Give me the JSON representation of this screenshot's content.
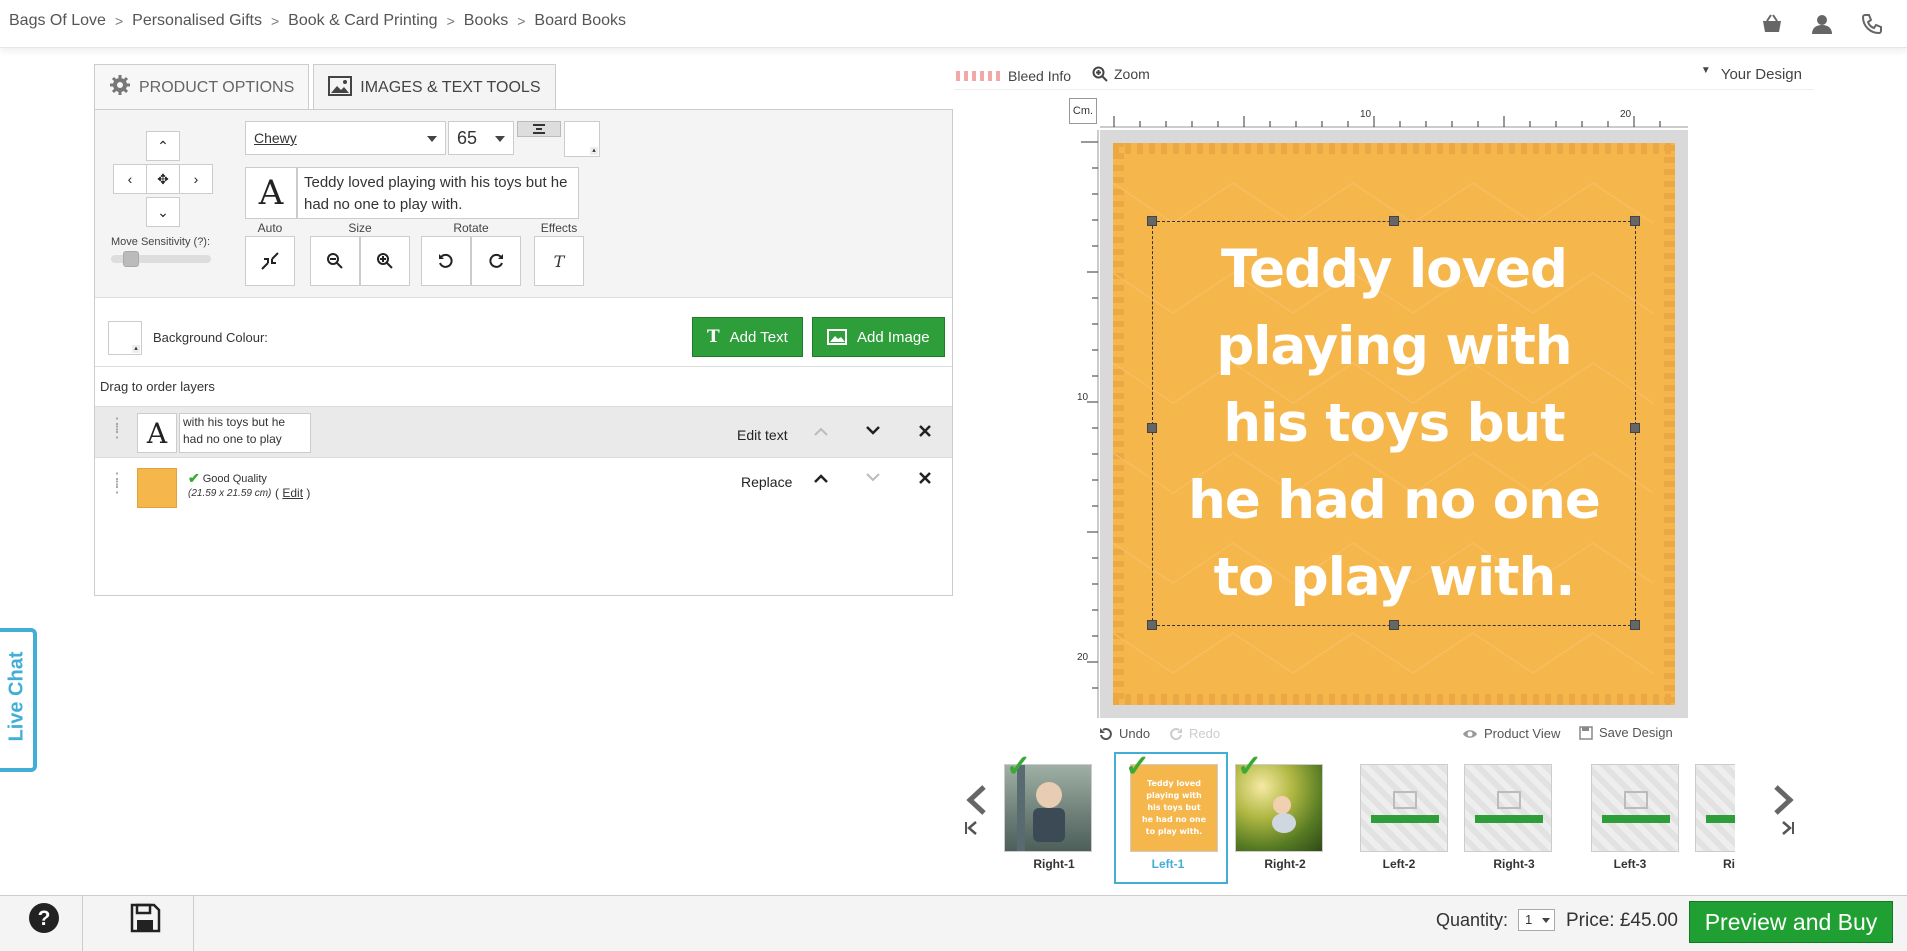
{
  "breadcrumb": [
    "Bags Of Love",
    "Personalised Gifts",
    "Book & Card Printing",
    "Books",
    "Board Books"
  ],
  "breadcrumb_sep": ">",
  "header_icons": [
    "basket-icon",
    "user-icon",
    "phone-icon"
  ],
  "tabs": [
    {
      "label": "PRODUCT OPTIONS",
      "icon": "gear-icon"
    },
    {
      "label": "IMAGES & TEXT TOOLS",
      "icon": "image-icon"
    }
  ],
  "text_tools": {
    "font": "Chewy",
    "font_size": "65",
    "text_value": "Teddy loved playing with his toys but he had no one to play with.",
    "move_sensitivity_label": "Move Sensitivity (?):",
    "labels": {
      "auto_size": "Auto Size",
      "size": "Size",
      "rotate": "Rotate",
      "effects": "Effects"
    }
  },
  "background": {
    "label": "Background Colour:"
  },
  "buttons": {
    "add_text": "Add Text",
    "add_image": "Add Image"
  },
  "layers": {
    "heading": "Drag to order layers",
    "items": [
      {
        "type": "text",
        "preview": "with his toys but he had no one to play",
        "action": "Edit text"
      },
      {
        "type": "image",
        "quality": "Good Quality",
        "dimensions": "(21.59 x 21.59 cm)",
        "edit_label": "Edit",
        "action": "Replace"
      }
    ]
  },
  "design_header": {
    "bleed_info": "Bleed Info",
    "zoom": "Zoom",
    "your_design": "Your Design"
  },
  "ruler": {
    "unit": "Cm.",
    "top_ticks": [
      "10",
      "20"
    ],
    "left_ticks": [
      "10",
      "20"
    ]
  },
  "canvas": {
    "quote_lines": [
      "Teddy loved",
      "playing with",
      "his toys but",
      "he had no one",
      "to play with."
    ],
    "background_color": "#f5b64c"
  },
  "canvas_actions": {
    "undo": "Undo",
    "redo": "Redo",
    "product_view": "Product View",
    "save_design": "Save Design"
  },
  "pages": [
    {
      "label": "Right-1",
      "checked": true,
      "kind": "photo-boy"
    },
    {
      "label": "Left-1",
      "checked": true,
      "kind": "text",
      "active": true
    },
    {
      "label": "Right-2",
      "checked": true,
      "kind": "photo-grass"
    },
    {
      "label": "Left-2",
      "checked": false,
      "kind": "blank"
    },
    {
      "label": "Right-3",
      "checked": false,
      "kind": "blank"
    },
    {
      "label": "Left-3",
      "checked": false,
      "kind": "blank"
    },
    {
      "label": "Ri",
      "checked": false,
      "kind": "blank"
    }
  ],
  "footer": {
    "quantity_label": "Quantity:",
    "quantity_value": "1",
    "price": "Price: £45.00",
    "preview_buy": "Preview and Buy"
  },
  "live_chat": "Live Chat",
  "colors": {
    "accent_green": "#2e9e3a",
    "canvas_orange": "#f5b64c",
    "live_chat": "#42aed8",
    "selected_thumb": "#42aed8"
  }
}
